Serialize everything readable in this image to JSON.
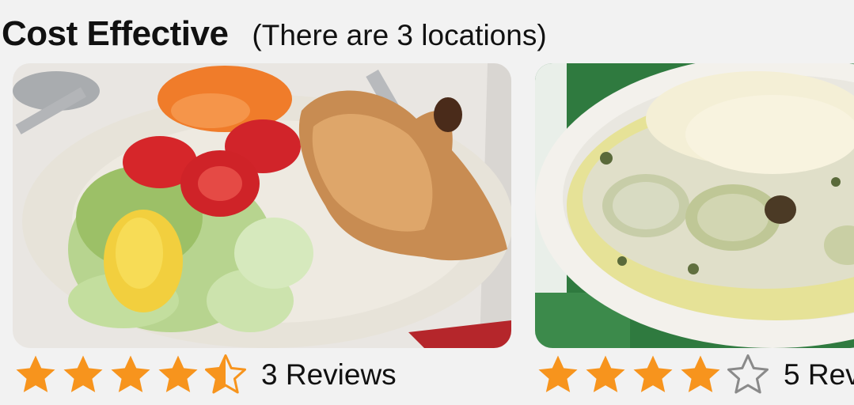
{
  "section": {
    "title": "Cost Effective",
    "subtitle": "(There are 3 locations)"
  },
  "colors": {
    "star_filled": "#f7941d",
    "star_empty_outline": "#8a8a8a"
  },
  "cards": [
    {
      "image_alt": "chicken-salad-plate",
      "rating": 4.5,
      "reviews_label": "3 Reviews"
    },
    {
      "image_alt": "zucchini-cheese-gratin-plate",
      "rating": 4,
      "reviews_label": "5 Rev"
    }
  ]
}
